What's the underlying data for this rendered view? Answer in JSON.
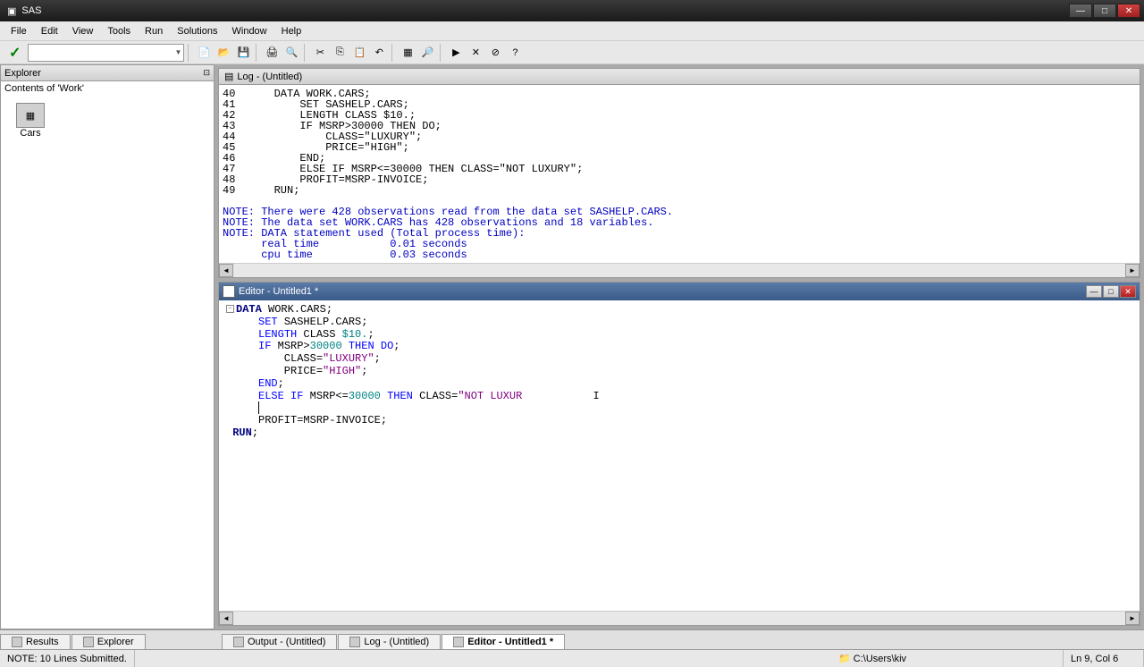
{
  "title": "SAS",
  "menu": [
    "File",
    "Edit",
    "View",
    "Tools",
    "Run",
    "Solutions",
    "Window",
    "Help"
  ],
  "explorer": {
    "title": "Explorer",
    "contents_label": "Contents of 'Work'",
    "items": [
      "Cars"
    ]
  },
  "log": {
    "title": "Log - (Untitled)",
    "lines": [
      {
        "n": "40",
        "t": "   DATA WORK.CARS;"
      },
      {
        "n": "41",
        "t": "       SET SASHELP.CARS;"
      },
      {
        "n": "42",
        "t": "       LENGTH CLASS $10.;"
      },
      {
        "n": "43",
        "t": "       IF MSRP>30000 THEN DO;"
      },
      {
        "n": "44",
        "t": "           CLASS=\"LUXURY\";"
      },
      {
        "n": "45",
        "t": "           PRICE=\"HIGH\";"
      },
      {
        "n": "46",
        "t": "       END;"
      },
      {
        "n": "47",
        "t": "       ELSE IF MSRP<=30000 THEN CLASS=\"NOT LUXURY\";"
      },
      {
        "n": "48",
        "t": "       PROFIT=MSRP-INVOICE;"
      },
      {
        "n": "49",
        "t": "   RUN;"
      }
    ],
    "notes": [
      "NOTE: There were 428 observations read from the data set SASHELP.CARS.",
      "NOTE: The data set WORK.CARS has 428 observations and 18 variables.",
      "NOTE: DATA statement used (Total process time):",
      "      real time           0.01 seconds",
      "      cpu time            0.03 seconds"
    ]
  },
  "editor": {
    "title": "Editor - Untitled1 *"
  },
  "tabs": {
    "left": [
      "Results",
      "Explorer"
    ],
    "right": [
      "Output - (Untitled)",
      "Log - (Untitled)",
      "Editor - Untitled1 *"
    ]
  },
  "status": {
    "message": "NOTE: 10 Lines Submitted.",
    "path": "C:\\Users\\kiv",
    "position": "Ln 9, Col 6"
  }
}
